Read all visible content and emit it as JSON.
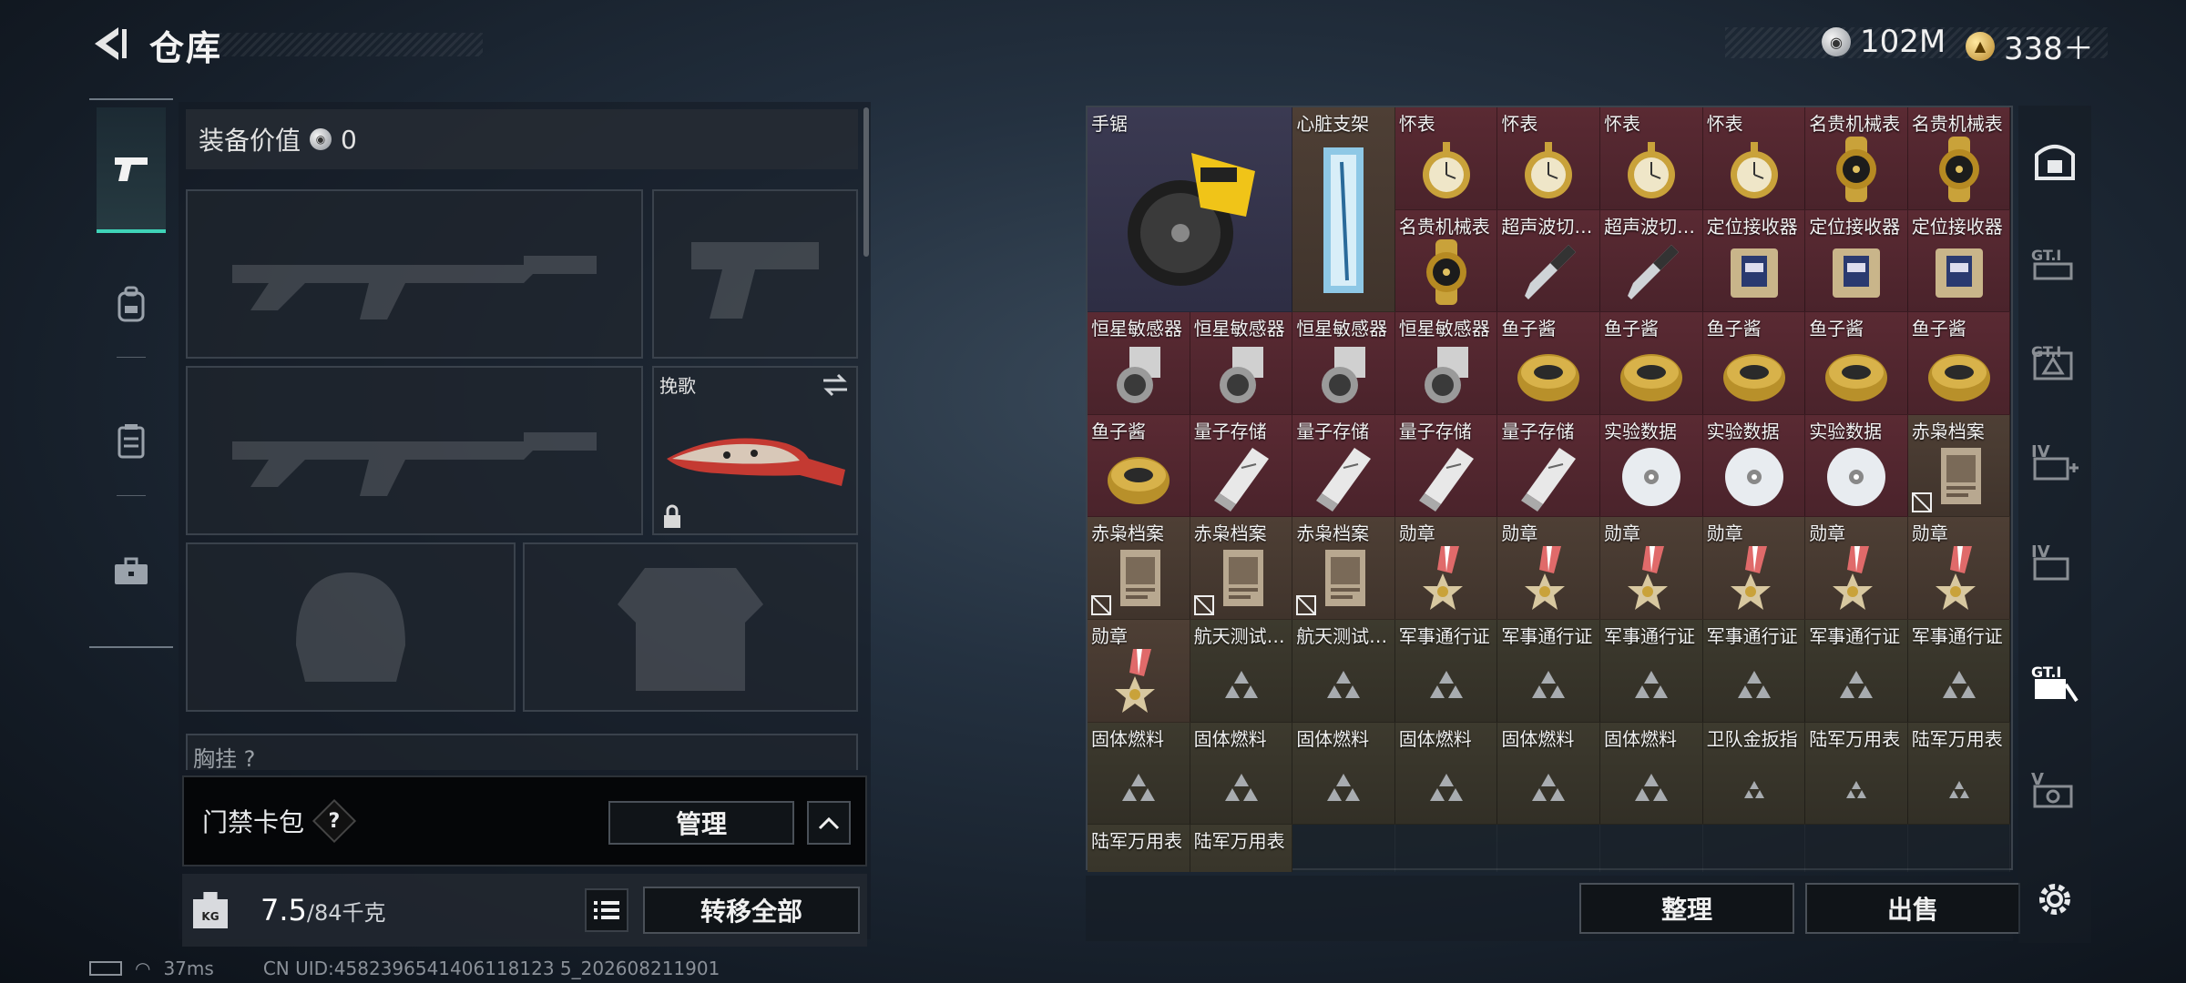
{
  "header": {
    "title": "仓库",
    "currency_silver": "102M",
    "currency_gold": "338＋"
  },
  "left": {
    "equip_value_label": "装备价值",
    "equip_value": "0",
    "melee_slot_name": "挽歌",
    "partial_label": "胸挂 ?",
    "cardpack_label": "门禁卡包",
    "cardpack_help": "?",
    "manage_label": "管理",
    "weight_value": "7.5",
    "weight_max": "/84千克",
    "weight_unit_badge": "KG",
    "transfer_all_label": "转移全部"
  },
  "right": {
    "sort_label": "整理",
    "sell_label": "出售",
    "tool_icons": [
      "safe-icon",
      "gt-icon-1",
      "gt-icon-2",
      "iv-plus-icon",
      "iv-icon",
      "gt-card-icon",
      "v-icon",
      "settings-icon"
    ],
    "big_items": [
      {
        "name": "手锯"
      },
      {
        "name": "心脏支架"
      }
    ],
    "rows": [
      [
        "怀表",
        "怀表",
        "怀表",
        "怀表",
        "名贵机械表",
        "名贵机械表"
      ],
      [
        "名贵机械表",
        "超声波切…",
        "超声波切…",
        "定位接收器",
        "定位接收器",
        "定位接收器"
      ],
      [
        "恒星敏感器",
        "恒星敏感器",
        "恒星敏感器",
        "恒星敏感器",
        "鱼子酱",
        "鱼子酱",
        "鱼子酱",
        "鱼子酱",
        "鱼子酱"
      ],
      [
        "鱼子酱",
        "量子存储",
        "量子存储",
        "量子存储",
        "量子存储",
        "实验数据",
        "实验数据",
        "实验数据",
        "赤枭档案"
      ],
      [
        "赤枭档案",
        "赤枭档案",
        "赤枭档案",
        "勋章",
        "勋章",
        "勋章",
        "勋章",
        "勋章",
        "勋章"
      ],
      [
        "勋章",
        "航天测试…",
        "航天测试…",
        "军事通行证",
        "军事通行证",
        "军事通行证",
        "军事通行证",
        "军事通行证",
        "军事通行证"
      ],
      [
        "固体燃料",
        "固体燃料",
        "固体燃料",
        "固体燃料",
        "固体燃料",
        "固体燃料",
        "卫队金扳指",
        "陆军万用表",
        "陆军万用表"
      ],
      [
        "陆军万用表",
        "陆军万用表"
      ]
    ]
  },
  "status": {
    "ping": "37ms",
    "uid": "CN UID:4582396541406118123 5_202608211901"
  }
}
